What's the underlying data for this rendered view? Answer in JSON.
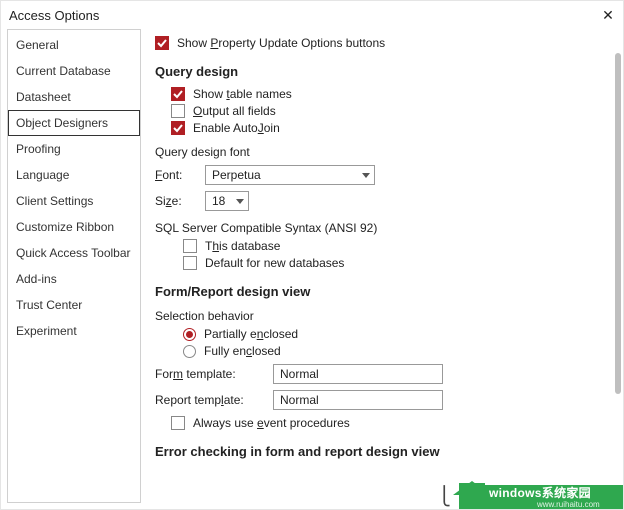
{
  "window": {
    "title": "Access Options",
    "close_glyph": "✕"
  },
  "sidebar": {
    "items": [
      {
        "label": "General"
      },
      {
        "label": "Current Database"
      },
      {
        "label": "Datasheet"
      },
      {
        "label": "Object Designers",
        "selected": true
      },
      {
        "label": "Proofing"
      },
      {
        "label": "Language"
      },
      {
        "label": "Client Settings"
      },
      {
        "label": "Customize Ribbon"
      },
      {
        "label": "Quick Access Toolbar"
      },
      {
        "label": "Add-ins"
      },
      {
        "label": "Trust Center"
      },
      {
        "label": "Experiment"
      }
    ]
  },
  "top": {
    "show_property_update": "Show Property Update Options buttons"
  },
  "query": {
    "section": "Query design",
    "show_table_names": "Show table names",
    "output_all_fields": "Output all fields",
    "enable_autojoin": "Enable AutoJoin",
    "font_header": "Query design font",
    "font_label": "Font:",
    "font_value": "Perpetua",
    "size_label": "Size:",
    "size_value": "18",
    "ansi_header": "SQL Server Compatible Syntax (ANSI 92)",
    "this_db": "This database",
    "default_new": "Default for new databases"
  },
  "form": {
    "section": "Form/Report design view",
    "selection_header": "Selection behavior",
    "partial": "Partially enclosed",
    "fully": "Fully enclosed",
    "form_template_label": "Form template:",
    "form_template_value": "Normal",
    "report_template_label": "Report template:",
    "report_template_value": "Normal",
    "always_event": "Always use event procedures"
  },
  "error_section": "Error checking in form and report design view",
  "decor": {
    "brand": "windows系统家园",
    "sub": "www.ruihaitu.com"
  }
}
